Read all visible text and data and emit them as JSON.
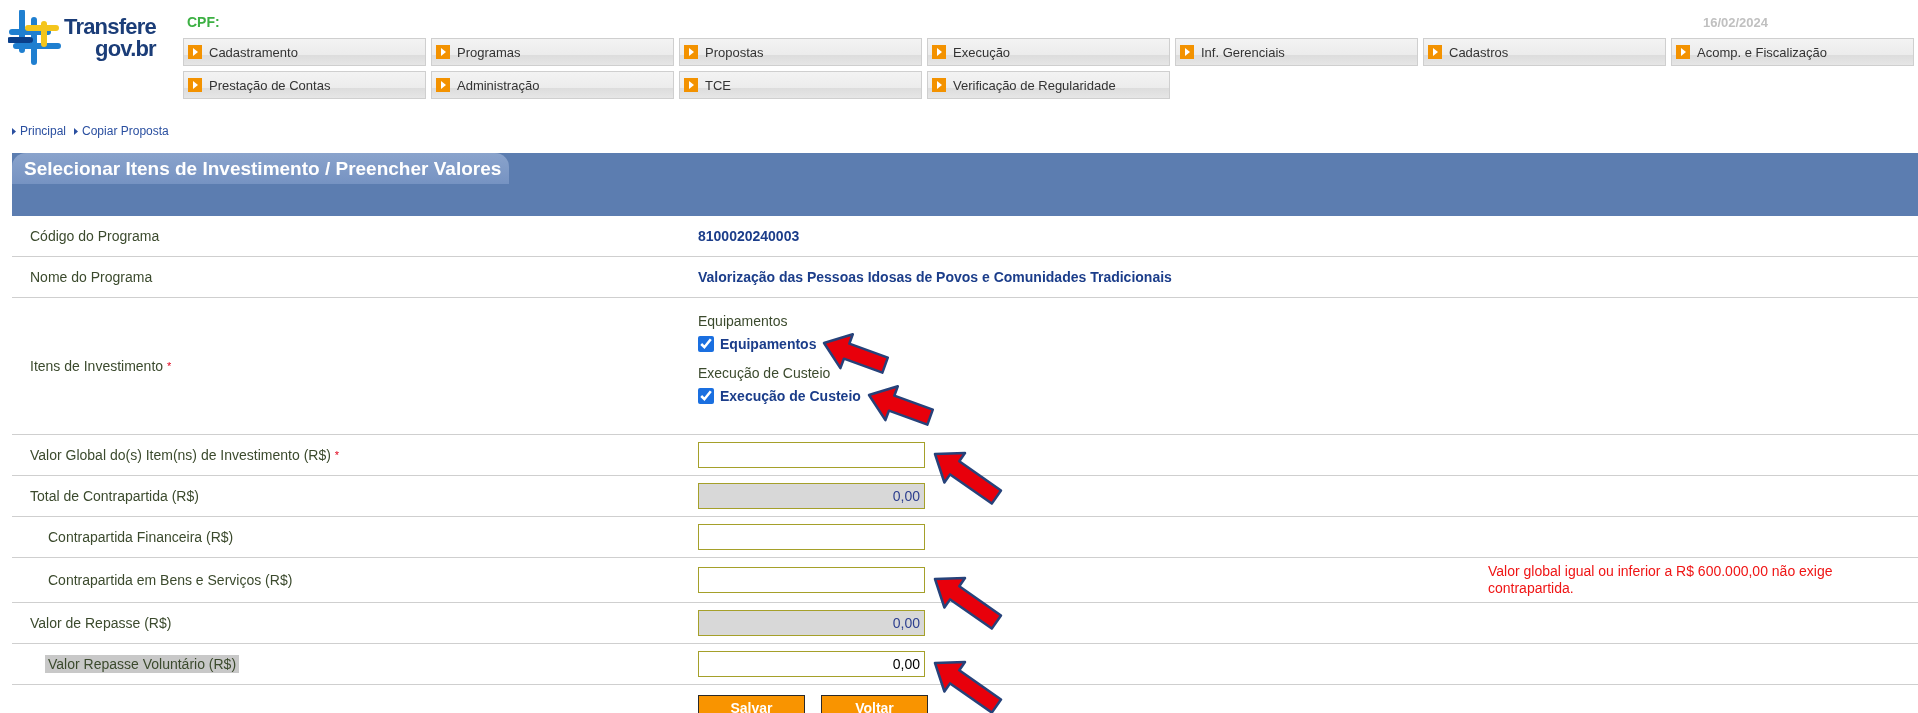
{
  "header": {
    "logo_top": "Transfere",
    "logo_bottom": "gov.br",
    "cpf_label": "CPF:",
    "date": "16/02/2024"
  },
  "menu": [
    {
      "label": "Cadastramento"
    },
    {
      "label": "Programas"
    },
    {
      "label": "Propostas"
    },
    {
      "label": "Execução"
    },
    {
      "label": "Inf. Gerenciais"
    },
    {
      "label": "Cadastros"
    },
    {
      "label": "Acomp. e Fiscalização"
    },
    {
      "label": "Prestação de Contas"
    },
    {
      "label": "Administração"
    },
    {
      "label": "TCE"
    },
    {
      "label": "Verificação de Regularidade"
    }
  ],
  "breadcrumb": [
    {
      "label": "Principal"
    },
    {
      "label": "Copiar Proposta"
    }
  ],
  "panel": {
    "title": "Selecionar Itens de Investimento / Preencher Valores"
  },
  "rows": [
    {
      "kind": "text",
      "label": "Código do Programa",
      "value": "8100020240003"
    },
    {
      "kind": "text",
      "label": "Nome do Programa",
      "value": "Valorização das Pessoas Idosas de Povos e Comunidades Tradicionais"
    },
    {
      "kind": "checks",
      "label": "Itens de Investimento",
      "required_mark": "*",
      "groups": [
        {
          "heading": "Equipamentos",
          "label": "Equipamentos",
          "checked": true,
          "pointed": true
        },
        {
          "heading": "Execução de Custeio",
          "label": "Execução de Custeio",
          "checked": true,
          "pointed": true
        }
      ]
    },
    {
      "kind": "input",
      "label": "Valor Global do(s) Item(ns) de Investimento (R$)",
      "required_mark": "*",
      "indented": false,
      "disabled": false,
      "highlighted": false,
      "pointed": true
    },
    {
      "kind": "input",
      "label": "Total de Contrapartida (R$)",
      "indented": false,
      "disabled": true,
      "highlighted": false,
      "pointed": false,
      "value": "0,00"
    },
    {
      "kind": "input",
      "label": "Contrapartida Financeira (R$)",
      "indented": true,
      "disabled": false,
      "highlighted": false,
      "pointed": false
    },
    {
      "kind": "input",
      "label": "Contrapartida em Bens e Serviços (R$)",
      "indented": true,
      "disabled": false,
      "highlighted": false,
      "pointed": true,
      "note": "Valor global igual ou inferior a R$ 600.000,00 não exige contrapartida."
    },
    {
      "kind": "input",
      "label": "Valor de Repasse (R$)",
      "indented": false,
      "disabled": true,
      "highlighted": false,
      "pointed": false,
      "value": "0,00"
    },
    {
      "kind": "input",
      "label": "Valor Repasse Voluntário (R$)",
      "indented": true,
      "disabled": false,
      "highlighted": true,
      "pointed": true,
      "value": "0,00"
    }
  ],
  "buttons": [
    {
      "label": "Salvar"
    },
    {
      "label": "Voltar"
    }
  ]
}
